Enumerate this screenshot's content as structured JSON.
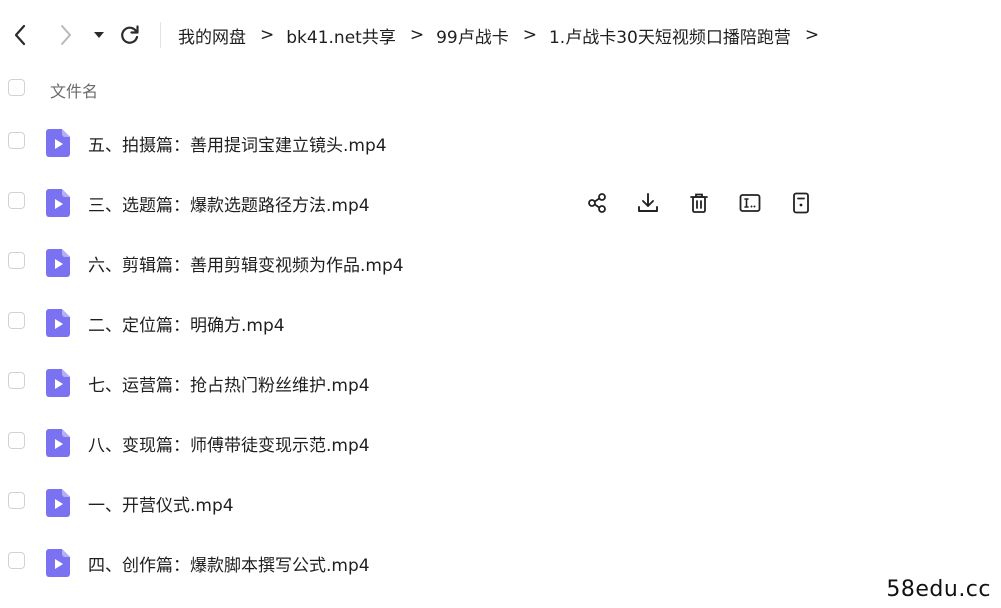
{
  "toolbar": {
    "back_icon": "chevron-left-icon",
    "forward_icon": "chevron-right-icon",
    "history_dropdown_icon": "caret-down-icon",
    "refresh_icon": "refresh-icon"
  },
  "breadcrumb": {
    "items": [
      "我的网盘",
      "bk41.net共享",
      "99卢战卡",
      "1.卢战卡30天短视频口播陪跑营"
    ],
    "separator": ">"
  },
  "list": {
    "column_name": "文件名",
    "files": [
      {
        "name": "五、拍摄篇：善用提词宝建立镜头.mp4"
      },
      {
        "name": "三、选题篇：爆款选题路径方法.mp4"
      },
      {
        "name": "六、剪辑篇：善用剪辑变视频为作品.mp4"
      },
      {
        "name": "二、定位篇：明确方.mp4"
      },
      {
        "name": "七、运营篇：抢占热门粉丝维护.mp4"
      },
      {
        "name": "八、变现篇：师傅带徒变现示范.mp4"
      },
      {
        "name": "一、开营仪式.mp4"
      },
      {
        "name": "四、创作篇：爆款脚本撰写公式.mp4"
      }
    ],
    "hover_row_actions": [
      "share-icon",
      "download-icon",
      "delete-icon",
      "rename-icon",
      "details-icon"
    ]
  },
  "colors": {
    "file_icon": "#7b72f2",
    "file_icon_fold": "#b5aff8",
    "text": "#1f1f1f",
    "muted": "#6b6b6b"
  },
  "watermark": "58edu.cc"
}
